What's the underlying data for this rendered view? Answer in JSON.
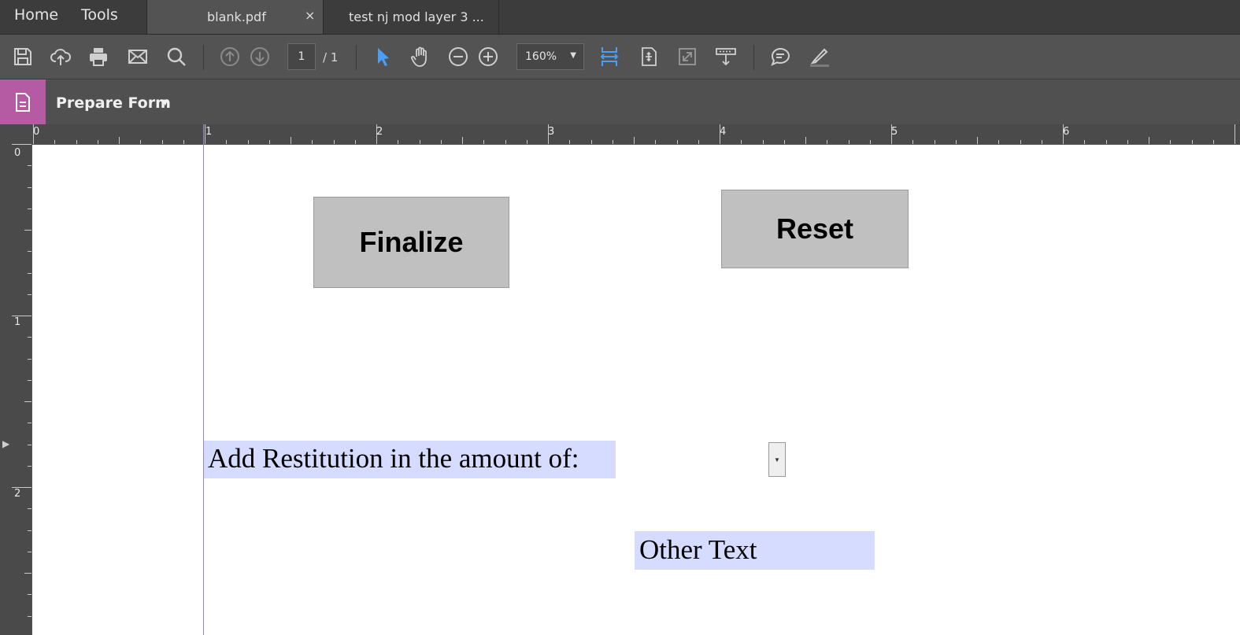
{
  "nav": {
    "home": "Home",
    "tools": "Tools"
  },
  "tabs": [
    {
      "label": "blank.pdf",
      "close": "×",
      "active": true
    },
    {
      "label": "test nj mod layer 3 ...",
      "active": false
    }
  ],
  "toolbar": {
    "icons": [
      "save-icon",
      "cloud-upload-icon",
      "print-icon",
      "email-icon",
      "search-icon",
      "prev-page-icon",
      "next-page-icon",
      "select-cursor-icon",
      "hand-icon",
      "zoom-out-icon",
      "zoom-in-icon",
      "fit-width-icon",
      "fit-page-icon",
      "full-screen-icon",
      "scroll-mode-icon",
      "comment-icon",
      "highlight-icon"
    ],
    "page_current": "1",
    "page_total": "/ 1",
    "zoom": "160%",
    "accent": "#4a9ff5"
  },
  "tool_panel": {
    "name": "Prepare Form",
    "icon": "form-document-icon",
    "icon_bg": "#b55ba3"
  },
  "rulers": {
    "horizontal": [
      "0",
      "1",
      "2",
      "3",
      "4",
      "5",
      "6"
    ],
    "vertical": [
      "0",
      "1",
      "2"
    ]
  },
  "form_fields": {
    "finalize_button": "Finalize",
    "reset_button": "Reset",
    "restitution_label": "Add Restitution in the amount of:",
    "other_text": "Other Text",
    "field_highlight": "#d5dcff"
  }
}
